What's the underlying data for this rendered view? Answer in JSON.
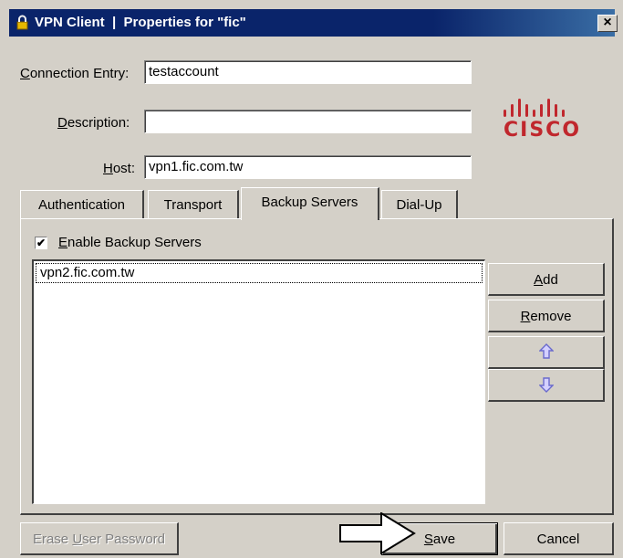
{
  "window": {
    "title": "VPN Client  |  Properties for \"fic\"",
    "close_glyph": "×"
  },
  "form": {
    "connection_entry": {
      "label_u": "C",
      "label_rest": "onnection Entry:",
      "value": "testaccount"
    },
    "description": {
      "label_u": "D",
      "label_rest": "escription:",
      "value": ""
    },
    "host": {
      "label_u": "H",
      "label_rest": "ost:",
      "value": "vpn1.fic.com.tw"
    }
  },
  "logo": {
    "text": "CISCO",
    "color": "#c0272d"
  },
  "tabs": [
    {
      "label": "Authentication"
    },
    {
      "label": "Transport"
    },
    {
      "label": "Backup Servers"
    },
    {
      "label": "Dial-Up"
    }
  ],
  "backup": {
    "enable_u": "E",
    "enable_rest": "nable Backup Servers",
    "enable_checked": true,
    "servers": [
      "vpn2.fic.com.tw"
    ]
  },
  "side_buttons": {
    "add_u": "A",
    "add_rest": "dd",
    "remove_u": "R",
    "remove_rest": "emove",
    "up_icon": "arrow-up-icon",
    "down_icon": "arrow-down-icon"
  },
  "footer": {
    "erase_pre": "Erase ",
    "erase_u": "U",
    "erase_post": "ser Password",
    "save_u": "S",
    "save_rest": "ave",
    "cancel": "Cancel"
  },
  "colors": {
    "titlebar": "#0a246a",
    "face": "#d4d0c8",
    "arrow_icon": "#6a6acc"
  }
}
